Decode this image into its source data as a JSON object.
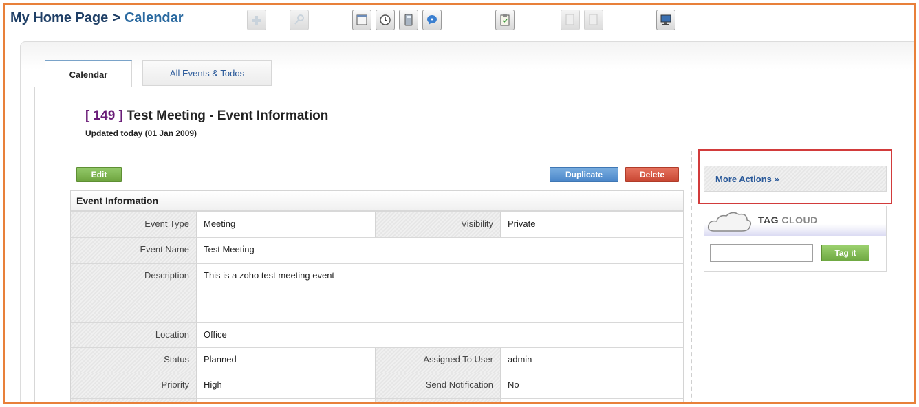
{
  "breadcrumb": {
    "home": "My Home Page",
    "separator": ">",
    "current": "Calendar"
  },
  "toolbar": {
    "icons": [
      "add-icon",
      "search-icon",
      "calendar-icon",
      "clock-icon",
      "calculator-icon",
      "chat-icon",
      "clipboard-icon",
      "import-icon",
      "export-icon",
      "monitor-icon"
    ]
  },
  "tabs": [
    {
      "label": "Calendar",
      "active": true
    },
    {
      "label": "All Events & Todos",
      "active": false
    }
  ],
  "record": {
    "id": "[ 149 ]",
    "title": "Test Meeting - Event Information",
    "updated": "Updated today (01 Jan 2009)"
  },
  "actions": {
    "edit": "Edit",
    "duplicate": "Duplicate",
    "delete": "Delete"
  },
  "section": {
    "title": "Event Information",
    "rows": [
      {
        "l1": "Event Type",
        "v1": "Meeting",
        "l2": "Visibility",
        "v2": "Private"
      },
      {
        "l1": "Event Name",
        "v1": "Test Meeting"
      },
      {
        "l1": "Description",
        "v1": "This is a zoho test meeting event"
      },
      {
        "l1": "Location",
        "v1": "Office"
      },
      {
        "l1": "Status",
        "v1": "Planned",
        "l2": "Assigned To User",
        "v2": "admin"
      },
      {
        "l1": "Priority",
        "v1": "High",
        "l2": "Send Notification",
        "v2": "No"
      }
    ]
  },
  "sidebar": {
    "more_actions": "More Actions »",
    "tag_cloud_main": "TAG",
    "tag_cloud_light": "CLOUD",
    "tag_button": "Tag it",
    "tag_input_value": ""
  },
  "colors": {
    "accent_frame": "#e8803a",
    "title_blue": "#1f3f66",
    "link_blue": "#2b5a9a",
    "record_id_purple": "#6a1d78",
    "edit_green": "#6ea43e",
    "duplicate_blue": "#4a86c9",
    "delete_red": "#c84632",
    "highlight_red": "#d23b3b"
  }
}
